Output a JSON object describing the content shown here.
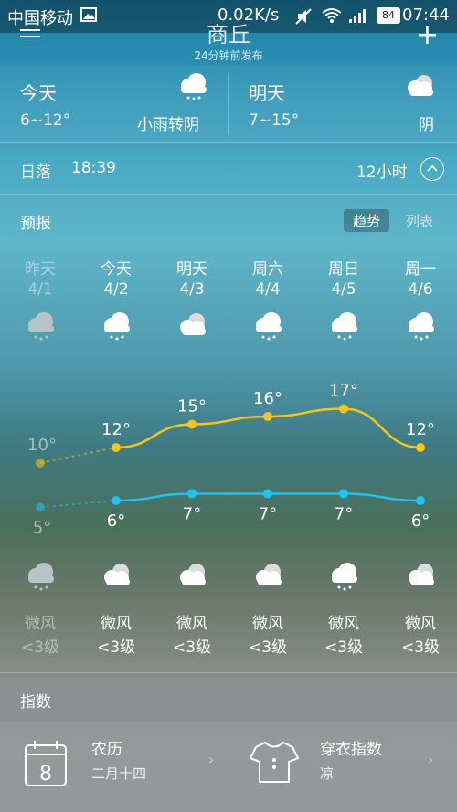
{
  "status_bar": {
    "carrier": "中国移动",
    "net_speed": "0.02K/s",
    "battery": "84",
    "time": "07:44"
  },
  "header": {
    "city": "商丘",
    "updated": "24分钟前发布"
  },
  "today": {
    "label": "今天",
    "temp": "6~12°",
    "condition": "小雨转阴",
    "icon": "light-rain-cloud"
  },
  "tomorrow": {
    "label": "明天",
    "temp": "7~15°",
    "condition": "阴",
    "icon": "overcast-cloud"
  },
  "sunset": {
    "label": "日落",
    "time": "18:39",
    "hours_label": "12小时"
  },
  "forecast": {
    "title": "预报",
    "view_trend": "趋势",
    "view_list": "列表",
    "days": [
      {
        "name": "昨天",
        "date": "4/1",
        "icon": "light-rain-cloud",
        "high": "10°",
        "low": "5°",
        "wind": "微风",
        "level": "<3级"
      },
      {
        "name": "今天",
        "date": "4/2",
        "icon": "light-rain-cloud",
        "high": "12°",
        "low": "6°",
        "wind": "微风",
        "level": "<3级"
      },
      {
        "name": "明天",
        "date": "4/3",
        "icon": "overcast-cloud",
        "high": "15°",
        "low": "7°",
        "wind": "微风",
        "level": "<3级"
      },
      {
        "name": "周六",
        "date": "4/4",
        "icon": "light-rain-cloud",
        "high": "16°",
        "low": "7°",
        "wind": "微风",
        "level": "<3级"
      },
      {
        "name": "周日",
        "date": "4/5",
        "icon": "light-rain-cloud",
        "high": "17°",
        "low": "7°",
        "wind": "微风",
        "level": "<3级"
      },
      {
        "name": "周一",
        "date": "4/6",
        "icon": "light-rain-cloud",
        "high": "12°",
        "low": "6°",
        "wind": "微风",
        "level": "<3级"
      }
    ],
    "night_icons": [
      "light-rain-cloud",
      "overcast-cloud",
      "overcast-cloud",
      "overcast-cloud",
      "light-rain-cloud",
      "overcast-cloud"
    ]
  },
  "chart_data": {
    "type": "line",
    "categories": [
      "4/1",
      "4/2",
      "4/3",
      "4/4",
      "4/5",
      "4/6"
    ],
    "series": [
      {
        "values": [
          10,
          12,
          15,
          16,
          17,
          12
        ],
        "color": "#f5c518"
      },
      {
        "values": [
          5,
          6,
          7,
          7,
          7,
          6
        ],
        "color": "#1fc3f0"
      }
    ]
  },
  "index": {
    "title": "指数",
    "items": [
      {
        "title": "农历",
        "value": "二月十四",
        "icon": "calendar-icon"
      },
      {
        "title": "穿衣指数",
        "value": "凉",
        "icon": "shirt-icon"
      }
    ]
  }
}
